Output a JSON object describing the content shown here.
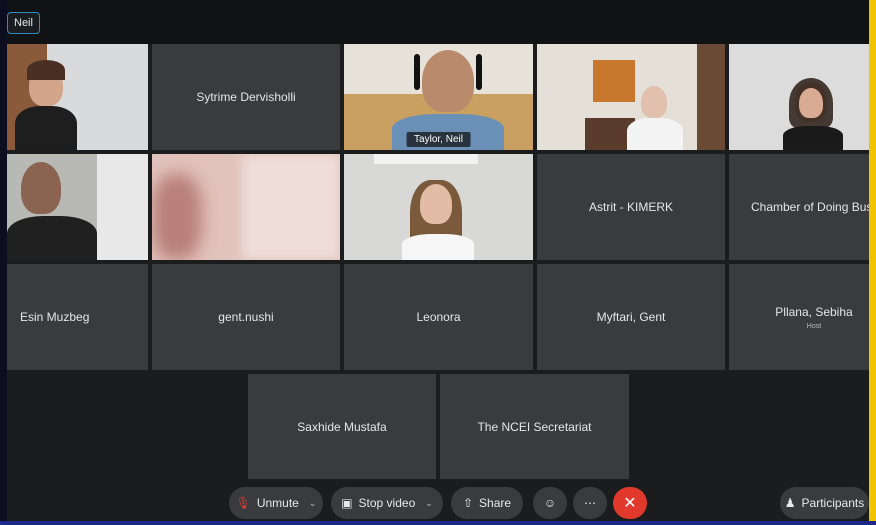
{
  "active_speaker": "Neil",
  "tiles": [
    {
      "name": "",
      "type": "video"
    },
    {
      "name": "Sytrime Dervisholli",
      "type": "avatar"
    },
    {
      "name": "Taylor, Neil",
      "type": "video"
    },
    {
      "name": "",
      "type": "video"
    },
    {
      "name": "",
      "type": "video"
    },
    {
      "name": "",
      "type": "video"
    },
    {
      "name": "",
      "type": "video"
    },
    {
      "name": "",
      "type": "video"
    },
    {
      "name": "Astrit - KIMERK",
      "type": "avatar"
    },
    {
      "name": "Chamber of Doing Bus",
      "type": "avatar"
    },
    {
      "name": "Esin Muzbeg",
      "type": "avatar"
    },
    {
      "name": "gent.nushi",
      "type": "avatar"
    },
    {
      "name": "Leonora",
      "type": "avatar"
    },
    {
      "name": "Myftari, Gent",
      "type": "avatar"
    },
    {
      "name": "Pllana, Sebiha",
      "sub": "Host",
      "type": "avatar"
    },
    {
      "name": "Saxhide Mustafa",
      "type": "avatar"
    },
    {
      "name": "The NCEI Secretariat",
      "type": "avatar"
    }
  ],
  "controls": {
    "unmute": "Unmute",
    "stop_video": "Stop video",
    "share": "Share",
    "reactions_icon": "smiley-icon",
    "more_icon": "more-icon",
    "leave_icon": "close-icon",
    "participants": "Participants"
  },
  "colors": {
    "active_border": "#29b6e8",
    "leave": "#e2392d",
    "tile_bg": "#3a3b3d"
  }
}
